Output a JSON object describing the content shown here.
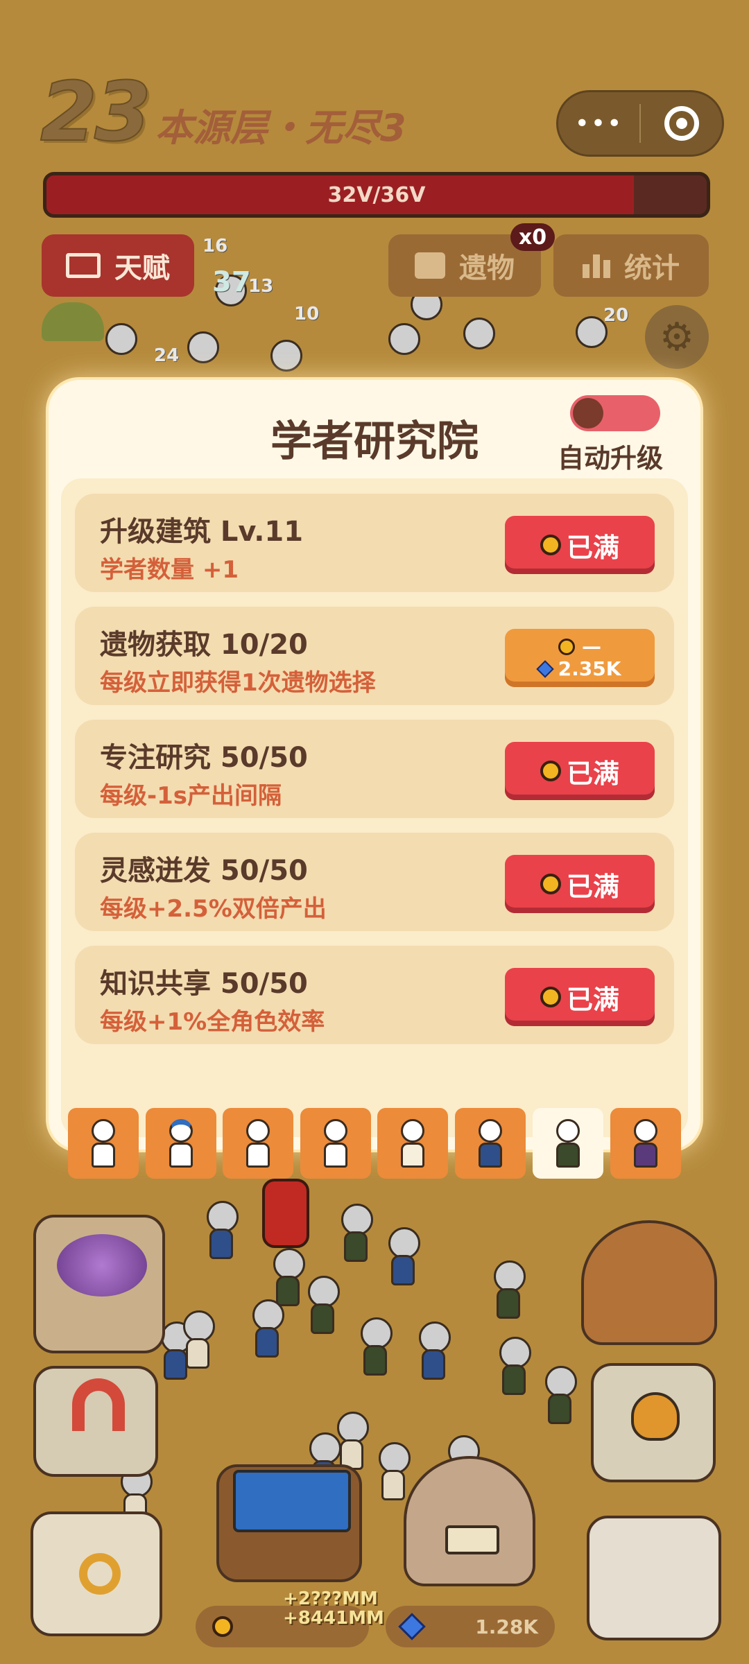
{
  "hud": {
    "level_number": "23",
    "level_name": "本源层・无尽3",
    "menu_dots": "•••",
    "hp_text": "32V/36V",
    "hp_fraction": 0.89
  },
  "top_buttons": {
    "talent_label": "天赋",
    "relic_label": "遗物",
    "relic_badge": "x0",
    "stats_label": "统计"
  },
  "battlefield_numbers": [
    "16",
    "37",
    "13",
    "10",
    "24",
    "20"
  ],
  "panel": {
    "title": "学者研究院",
    "auto_upgrade_label": "自动升级",
    "auto_upgrade_on": false,
    "rows": [
      {
        "title": "升级建筑 Lv.11",
        "desc": "学者数量 +1",
        "button": "已满",
        "state": "full"
      },
      {
        "title": "遗物获取 10/20",
        "desc": "每级立即获得1次遗物选择",
        "cost_coin": "—",
        "cost_gem": "2.35K",
        "state": "cost"
      },
      {
        "title": "专注研究 50/50",
        "desc": "每级-1s产出间隔",
        "button": "已满",
        "state": "full"
      },
      {
        "title": "灵感迸发 50/50",
        "desc": "每级+2.5%双倍产出",
        "button": "已满",
        "state": "full"
      },
      {
        "title": "知识共享 50/50",
        "desc": "每级+1%全角色效率",
        "button": "已满",
        "state": "full"
      }
    ]
  },
  "character_tabs": [
    "worker",
    "porter",
    "smith",
    "merchant",
    "priest",
    "mage",
    "scholar",
    "wizard"
  ],
  "currency": {
    "coin_float_1": "+2???MM",
    "coin_float_2": "+8441MM",
    "gem_value": "1.28K"
  },
  "colors": {
    "accent_red": "#e9424a",
    "accent_orange": "#f09a3e",
    "panel_bg": "#fff8e6",
    "hp_red": "#9b1f22"
  }
}
